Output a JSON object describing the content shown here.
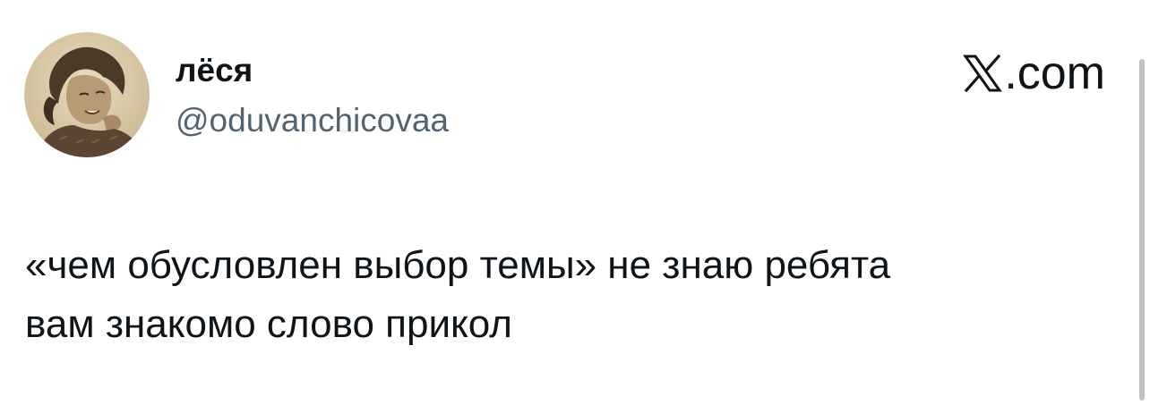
{
  "tweet": {
    "author": {
      "display_name": "лёся",
      "handle": "@oduvanchicovaa",
      "avatar_icon": "profile-photo-avatar"
    },
    "brand": {
      "icon": "x-logo-icon",
      "text": ".com"
    },
    "text_lines": [
      "«чем обусловлен выбор темы» не знаю ребята",
      "вам знакомо слово прикол"
    ]
  },
  "colors": {
    "background": "#ffffff",
    "primary_text": "#0f1419",
    "secondary_text": "#536471",
    "scrollbar_thumb": "#c2c2c2"
  }
}
